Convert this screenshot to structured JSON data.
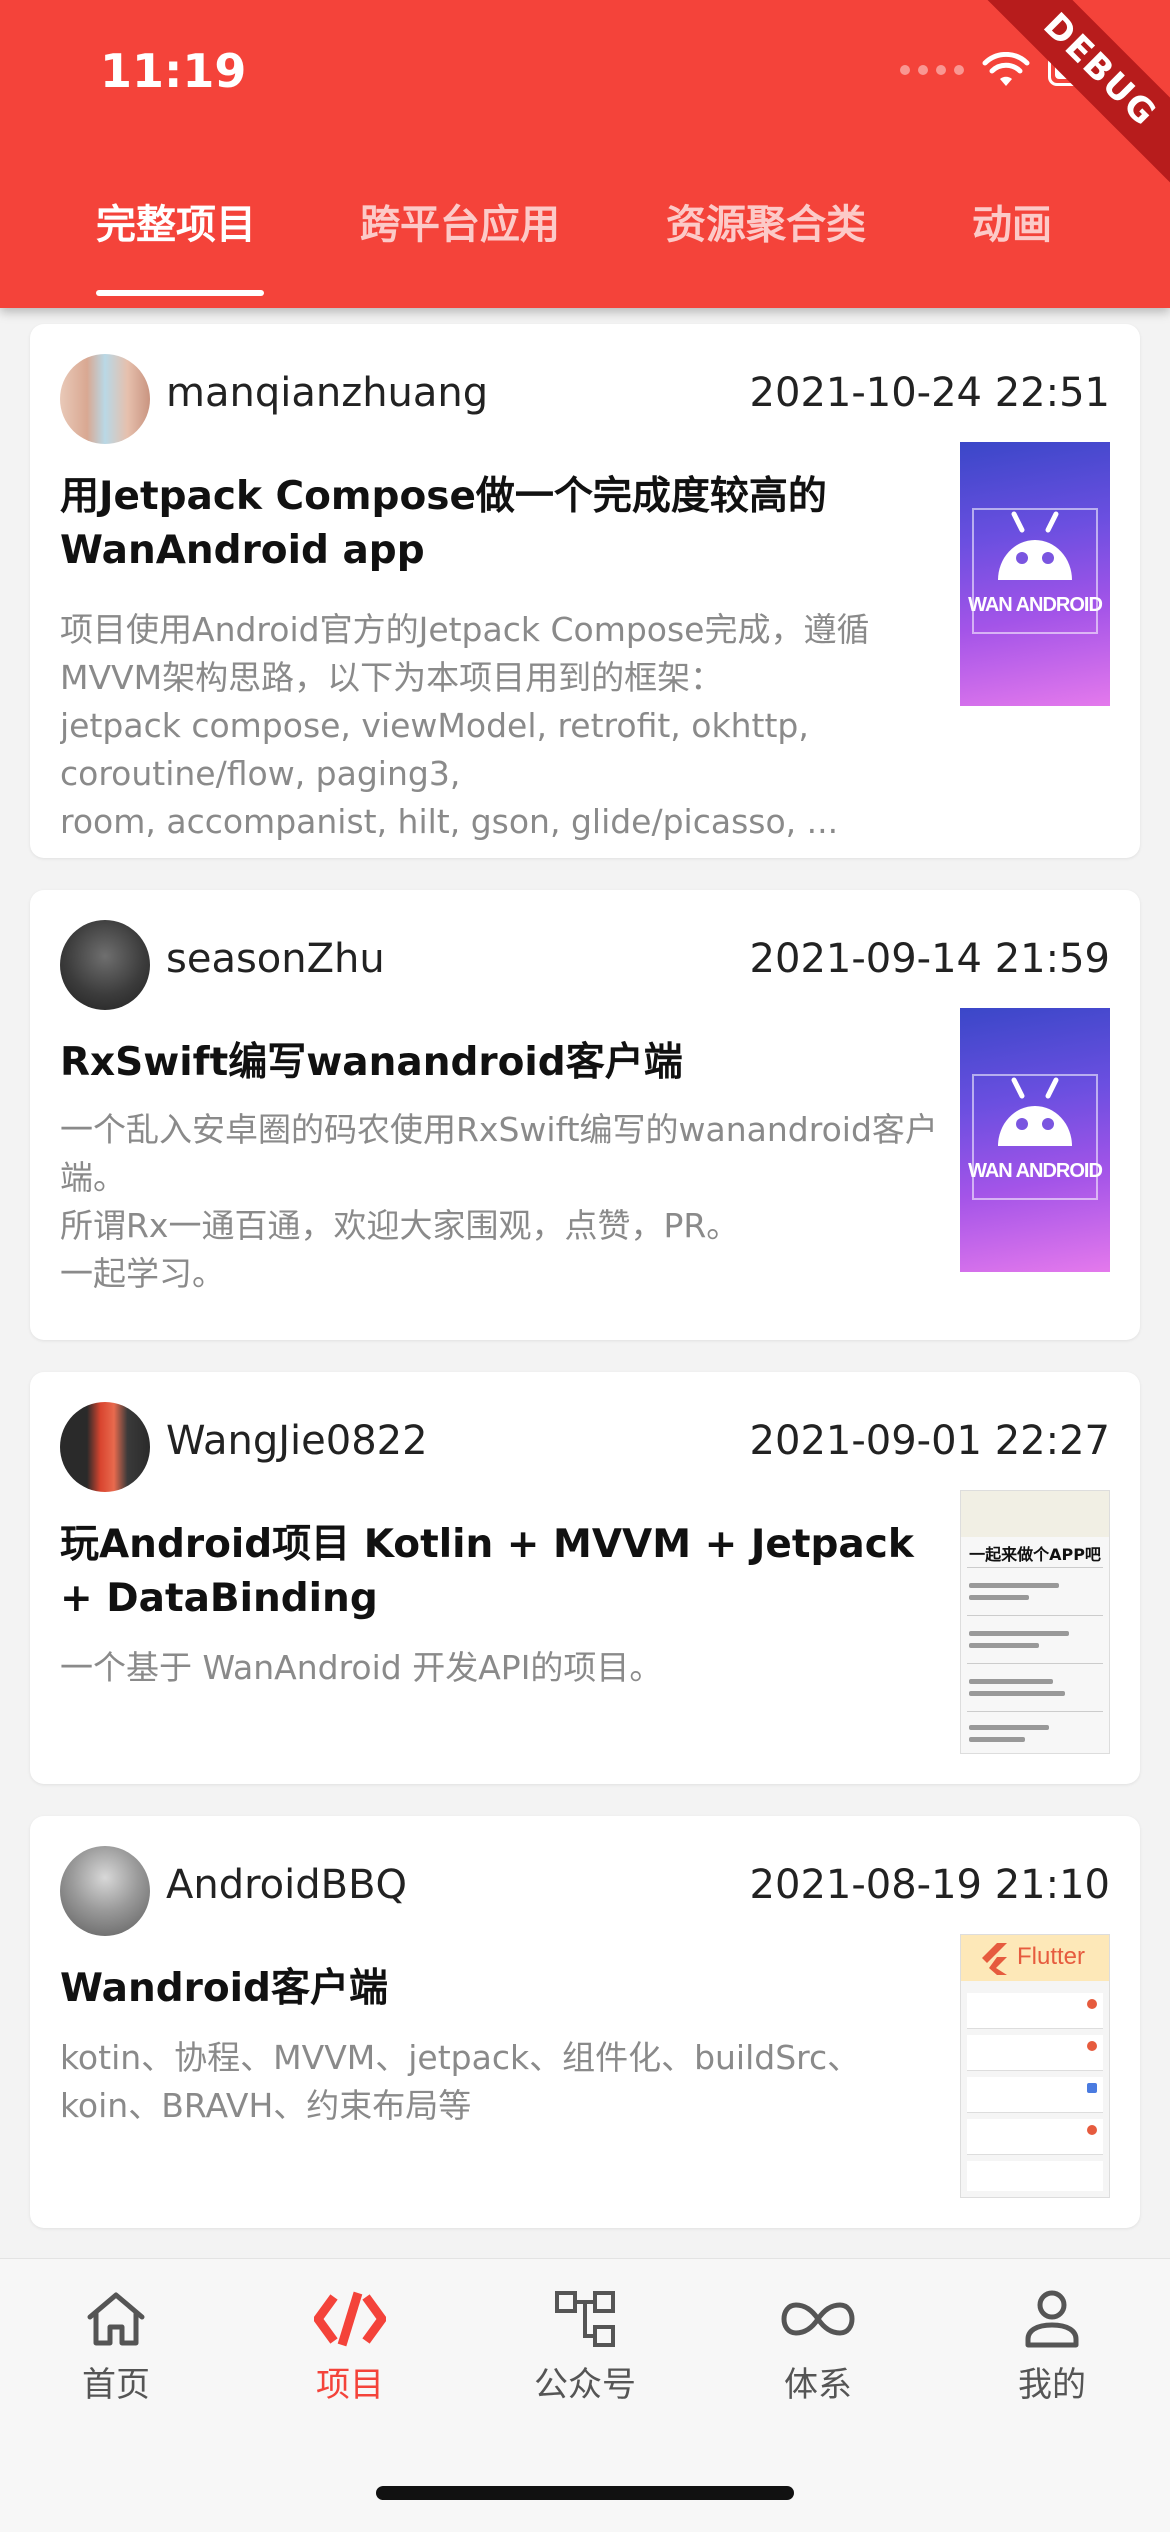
{
  "status_bar": {
    "time": "11:19",
    "debug_banner": "DEBUG"
  },
  "tabs": [
    {
      "label": "完整项目",
      "active": true
    },
    {
      "label": "跨平台应用",
      "active": false
    },
    {
      "label": "资源聚合类",
      "active": false
    },
    {
      "label": "动画",
      "active": false
    }
  ],
  "projects": [
    {
      "author": "manqianzhuang",
      "date": "2021-10-24 22:51",
      "title": "用Jetpack Compose做一个完成度较高的WanAndroid app",
      "desc": "项目使用Android官方的Jetpack Compose完成，遵循MVVM架构思路，以下为本项目用到的框架：\njetpack compose, viewModel, retrofit, okhttp, coroutine/flow, paging3,\nroom, accompanist, hilt, gson, glide/picasso, ...",
      "thumb_text": "WAN ANDROID"
    },
    {
      "author": "seasonZhu",
      "date": "2021-09-14 21:59",
      "title": "RxSwift编写wanandroid客户端",
      "desc": "一个乱入安卓圈的码农使用RxSwift编写的wanandroid客户端。\n所谓Rx一通百通，欢迎大家围观，点赞，PR。\n一起学习。",
      "thumb_text": "WAN ANDROID"
    },
    {
      "author": "WangJie0822",
      "date": "2021-09-01 22:27",
      "title": "玩Android项目 Kotlin + MVVM + Jetpack + DataBinding",
      "desc": "一个基于 WanAndroid 开发API的项目。",
      "thumb_text": "一起来做个APP吧"
    },
    {
      "author": "AndroidBBQ",
      "date": "2021-08-19 21:10",
      "title": "Wandroid客户端",
      "desc": "kotin、协程、MVVM、jetpack、组件化、buildSrc、koin、BRAVH、约束布局等",
      "thumb_text": "Flutter"
    }
  ],
  "bottom_nav": [
    {
      "label": "首页",
      "icon": "home-icon",
      "active": false
    },
    {
      "label": "项目",
      "icon": "code-icon",
      "active": true
    },
    {
      "label": "公众号",
      "icon": "hierarchy-icon",
      "active": false
    },
    {
      "label": "体系",
      "icon": "infinity-icon",
      "active": false
    },
    {
      "label": "我的",
      "icon": "person-icon",
      "active": false
    }
  ],
  "colors": {
    "primary": "#f4433a",
    "background": "#f3f3f3",
    "desc_text": "#8a8a8a"
  }
}
